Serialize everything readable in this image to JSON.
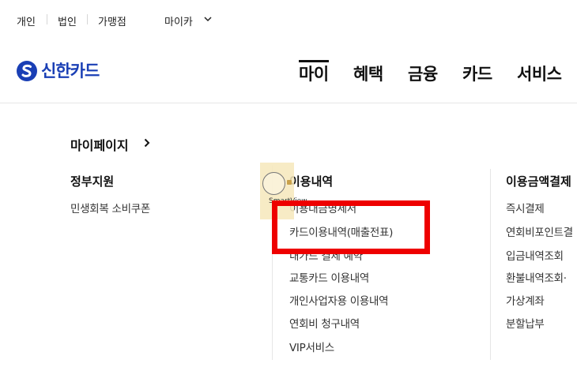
{
  "top_links": [
    "개인",
    "법인",
    "가맹점"
  ],
  "top_dropdown": {
    "label": "마이카"
  },
  "brand": {
    "name": "신한카드",
    "color": "#1a3fb5"
  },
  "gnb": {
    "items": [
      "마이",
      "혜택",
      "금융",
      "카드",
      "서비스"
    ],
    "active": "마이"
  },
  "mega_menu": {
    "title": "마이페이지",
    "columns": [
      {
        "title": "정부지원",
        "items": [
          "민생회복 소비쿠폰"
        ]
      },
      {
        "title": "이용내역",
        "items": [
          "이용대금명세서",
          "카드이용내역(매출전표)",
          "내가드 결제 예약",
          "교통카드 이용내역",
          "개인사업자용 이용내역",
          "연회비 청구내역",
          "VIP서비스"
        ]
      },
      {
        "title": "이용금액결제",
        "items": [
          "즉시결제",
          "연회비포인트결",
          "입금내역조회",
          "환불내역조회·",
          "가상계좌",
          "분할납부"
        ]
      }
    ]
  },
  "overlay": {
    "smartview_label": "SmartView",
    "highlight_color": "#ee0000"
  }
}
